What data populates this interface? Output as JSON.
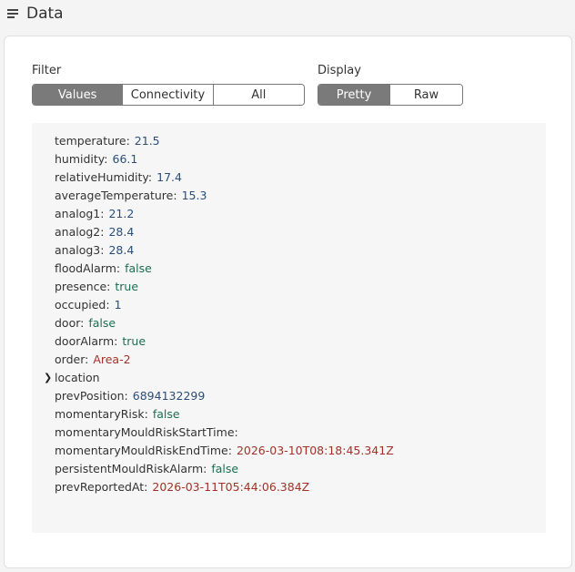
{
  "header": {
    "title": "Data",
    "icon": "menu-icon"
  },
  "filter": {
    "label": "Filter",
    "options": [
      "Values",
      "Connectivity",
      "All"
    ],
    "selected": "Values"
  },
  "display": {
    "label": "Display",
    "options": [
      "Pretty",
      "Raw"
    ],
    "selected": "Pretty"
  },
  "fields": [
    {
      "key": "temperature:",
      "value": "21.5",
      "type": "num"
    },
    {
      "key": "humidity:",
      "value": "66.1",
      "type": "num"
    },
    {
      "key": "relativeHumidity:",
      "value": "17.4",
      "type": "num"
    },
    {
      "key": "averageTemperature:",
      "value": "15.3",
      "type": "num"
    },
    {
      "key": "analog1:",
      "value": "21.2",
      "type": "num"
    },
    {
      "key": "analog2:",
      "value": "28.4",
      "type": "num"
    },
    {
      "key": "analog3:",
      "value": "28.4",
      "type": "num"
    },
    {
      "key": "floodAlarm:",
      "value": "false",
      "type": "bool"
    },
    {
      "key": "presence:",
      "value": "true",
      "type": "bool"
    },
    {
      "key": "occupied:",
      "value": "1",
      "type": "num"
    },
    {
      "key": "door:",
      "value": "false",
      "type": "bool"
    },
    {
      "key": "doorAlarm:",
      "value": "true",
      "type": "bool"
    },
    {
      "key": "order:",
      "value": "Area-2",
      "type": "str"
    },
    {
      "key": "location",
      "value": "",
      "type": "object",
      "expandable": true
    },
    {
      "key": "prevPosition:",
      "value": "6894132299",
      "type": "num"
    },
    {
      "key": "momentaryRisk:",
      "value": "false",
      "type": "bool"
    },
    {
      "key": "momentaryMouldRiskStartTime:",
      "value": "",
      "type": "str"
    },
    {
      "key": "momentaryMouldRiskEndTime:",
      "value": "2026-03-10T08:18:45.341Z",
      "type": "str"
    },
    {
      "key": "persistentMouldRiskAlarm:",
      "value": "false",
      "type": "bool"
    },
    {
      "key": "prevReportedAt:",
      "value": "2026-03-11T05:44:06.384Z",
      "type": "str"
    }
  ],
  "colors": {
    "number": "#2b4f7a",
    "boolean": "#1e6e52",
    "string": "#a33229",
    "active_segment": "#7a7a7a"
  }
}
